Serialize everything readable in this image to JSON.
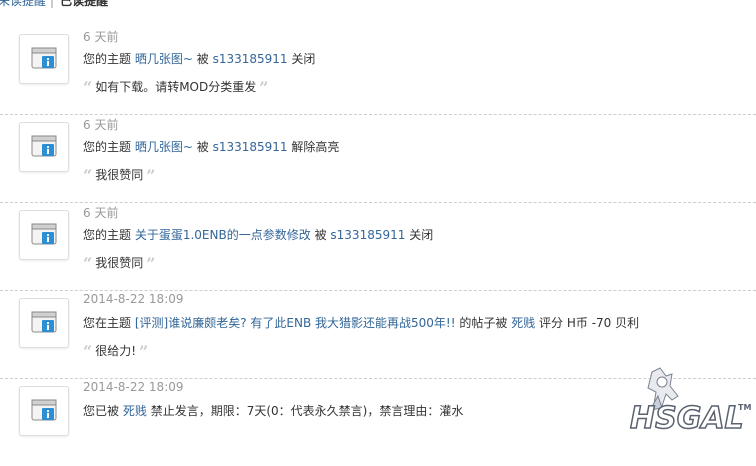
{
  "tabs": {
    "unread_label": "未读提醒",
    "separator": "|",
    "read_label": "已读提醒"
  },
  "notices": [
    {
      "time": "6 天前",
      "prefix": "您的主题",
      "link": "晒几张图~",
      "mid": "被",
      "user": "s133185911",
      "action": "关闭",
      "quote": "如有下载。请转MOD分类重发"
    },
    {
      "time": "6 天前",
      "prefix": "您的主题",
      "link": "晒几张图~",
      "mid": "被",
      "user": "s133185911",
      "action": "解除高亮",
      "quote": "我很赞同"
    },
    {
      "time": "6 天前",
      "prefix": "您的主题",
      "link": "关于蛋蛋1.0ENB的一点参数修改",
      "mid": "被",
      "user": "s133185911",
      "action": "关闭",
      "quote": "我很赞同"
    },
    {
      "time": "2014-8-22 18:09",
      "prefix": "您在主题",
      "link": "[评测]谁说廉颇老矣? 有了此ENB 我大猎影还能再战500年!!",
      "mid": "的帖子被",
      "user": "死贱",
      "action": "评分 H币 -70 贝利",
      "quote": "很给力!"
    },
    {
      "time": "2014-8-22 18:09",
      "prefix": "您已被",
      "link": "",
      "mid": "",
      "user": "死贱",
      "action": "禁止发言，期限：7天(0：代表永久禁言)，禁言理由：灌水",
      "quote": ""
    }
  ],
  "logo": {
    "text": "HSGAL",
    "tm": "TM"
  },
  "colors": {
    "link": "#336699",
    "muted": "#999999",
    "icon_blue": "#2a8fd4"
  },
  "icon": "info-notice-icon"
}
